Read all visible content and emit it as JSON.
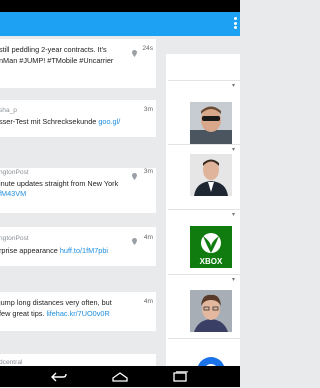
{
  "timeline": {
    "tweets": [
      {
        "lines": [
          {
            "text": "still peddling 2-year contracts. It's"
          },
          {
            "text": "nMan #JUMP! #TMobile #Uncarrier"
          }
        ],
        "time": "24s",
        "has_geo": true
      },
      {
        "lines": [
          {
            "text": "sha_p",
            "meta": true
          },
          {
            "text": "sser-Test mit Schrecksekunde ",
            "link": "goo.gl/"
          }
        ],
        "time": "3m",
        "has_geo": false
      },
      {
        "lines": [
          {
            "text": "ngtonPost",
            "meta": true
          },
          {
            "text": "inute updates straight from New York"
          },
          {
            "text": "",
            "link": "fM43VM"
          }
        ],
        "time": "3m",
        "has_geo": true
      },
      {
        "lines": [
          {
            "text": "ngtonPost",
            "meta": true
          },
          {
            "text": "rprise appearance  ",
            "link": "huff.to/1fM7pbi"
          }
        ],
        "time": "4m",
        "has_geo": true
      },
      {
        "lines": [
          {
            "text": "jump long distances very often, but"
          },
          {
            "text": " few great tips. ",
            "link": "lifehac.kr/7UO0v0R"
          }
        ],
        "time": "4m",
        "has_geo": false
      },
      {
        "lines": [
          {
            "text": "dcentral",
            "meta": true
          }
        ],
        "time": "",
        "has_geo": false
      }
    ]
  },
  "right_panel": {
    "suggestions": [
      {
        "name": "man-with-sunglasses",
        "mark": "▾"
      },
      {
        "name": "man-in-suit",
        "mark": "▾"
      },
      {
        "name": "xbox-logo",
        "mark": "▾",
        "logo_text": "XBOX"
      },
      {
        "name": "person-with-glasses",
        "mark": "▾"
      },
      {
        "name": "blue-logo",
        "mark": ""
      }
    ]
  },
  "colors": {
    "accent": "#1da1f2",
    "link": "#1d8ee0",
    "xbox_green": "#107c10"
  },
  "icons": {
    "overflow": "overflow-menu-icon",
    "geo": "location-pin-icon",
    "back": "back-icon",
    "home": "home-icon",
    "recents": "recent-apps-icon"
  }
}
